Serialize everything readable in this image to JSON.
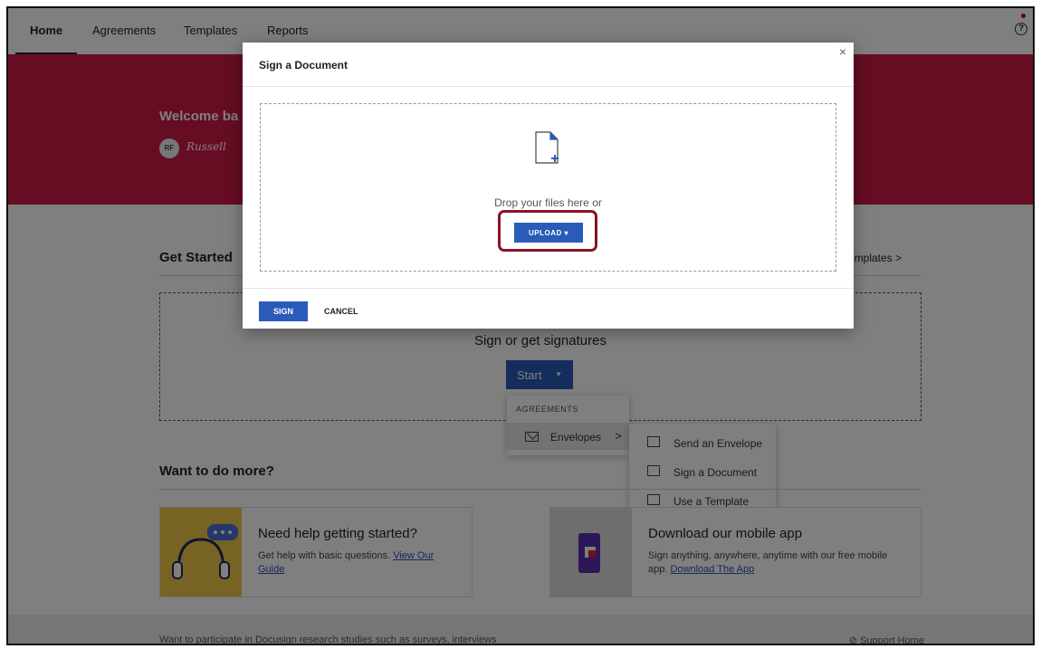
{
  "nav": {
    "tabs": [
      "Home",
      "Agreements",
      "Templates",
      "Reports"
    ]
  },
  "banner": {
    "welcome": "Welcome ba",
    "avatar_initials": "RF",
    "signature": "Russell"
  },
  "get_started": {
    "title": "Get Started",
    "templates_link": "Templates  >",
    "sign_or_get": "Sign or get signatures",
    "start_label": "Start"
  },
  "start_menu": {
    "header": "AGREEMENTS",
    "envelopes": "Envelopes",
    "submenu": [
      "Send an Envelope",
      "Sign a Document",
      "Use a Template"
    ]
  },
  "more": {
    "title": "Want to do more?",
    "help_card": {
      "title": "Need help getting started?",
      "desc": "Get help with basic questions.",
      "link1": "View Our",
      "link2": "Guide"
    },
    "mobile_card": {
      "title": "Download our mobile app",
      "desc": "Sign anything, anywhere, anytime with our free mobile app.",
      "link": "Download The App"
    }
  },
  "footer": {
    "left": "Want to participate in Docusign research studies such as surveys, interviews",
    "right": "Support Home"
  },
  "modal": {
    "title": "Sign a Document",
    "close": "×",
    "drop_text": "Drop your files here or",
    "upload_label": "UPLOAD",
    "sign_label": "SIGN",
    "cancel_label": "CANCEL"
  },
  "colors": {
    "banner": "#cc1a47",
    "primary_button": "#2a5bb8",
    "highlight_ring": "#8b1125"
  }
}
